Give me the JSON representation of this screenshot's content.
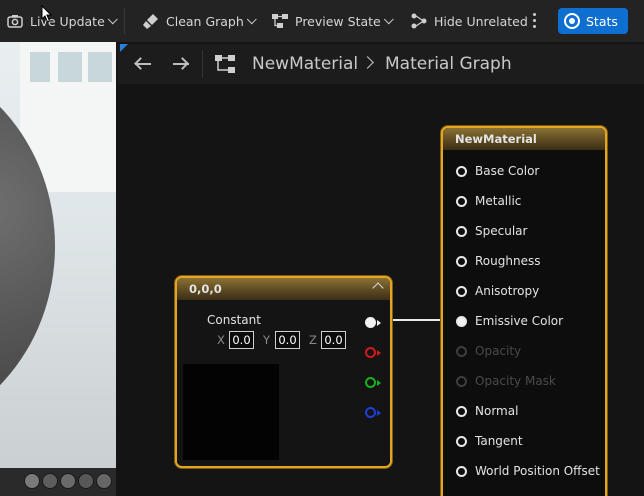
{
  "toolbar": {
    "live_update": "Live Update",
    "clean_graph": "Clean Graph",
    "preview_state": "Preview State",
    "hide_unrelated": "Hide Unrelated",
    "stats": "Stats"
  },
  "breadcrumb": {
    "asset": "NewMaterial",
    "graph": "Material Graph"
  },
  "constant_node": {
    "title": "0,0,0",
    "label": "Constant",
    "x_label": "X",
    "y_label": "Y",
    "z_label": "Z",
    "x": "0.0",
    "y": "0.0",
    "z": "0.0",
    "pin_colors": [
      "#f2f2f2",
      "#d11a1a",
      "#17b31f",
      "#1e3fd6"
    ]
  },
  "material_node": {
    "title": "NewMaterial",
    "pins": [
      {
        "label": "Base Color",
        "enabled": true,
        "connected": false
      },
      {
        "label": "Metallic",
        "enabled": true,
        "connected": false
      },
      {
        "label": "Specular",
        "enabled": true,
        "connected": false
      },
      {
        "label": "Roughness",
        "enabled": true,
        "connected": false
      },
      {
        "label": "Anisotropy",
        "enabled": true,
        "connected": false
      },
      {
        "label": "Emissive Color",
        "enabled": true,
        "connected": true
      },
      {
        "label": "Opacity",
        "enabled": false,
        "connected": false
      },
      {
        "label": "Opacity Mask",
        "enabled": false,
        "connected": false
      },
      {
        "label": "Normal",
        "enabled": true,
        "connected": false
      },
      {
        "label": "Tangent",
        "enabled": true,
        "connected": false
      },
      {
        "label": "World Position Offset",
        "enabled": true,
        "connected": false
      }
    ]
  },
  "colors": {
    "node_border": "#e6a521",
    "stats_button": "#0f6fd1"
  }
}
